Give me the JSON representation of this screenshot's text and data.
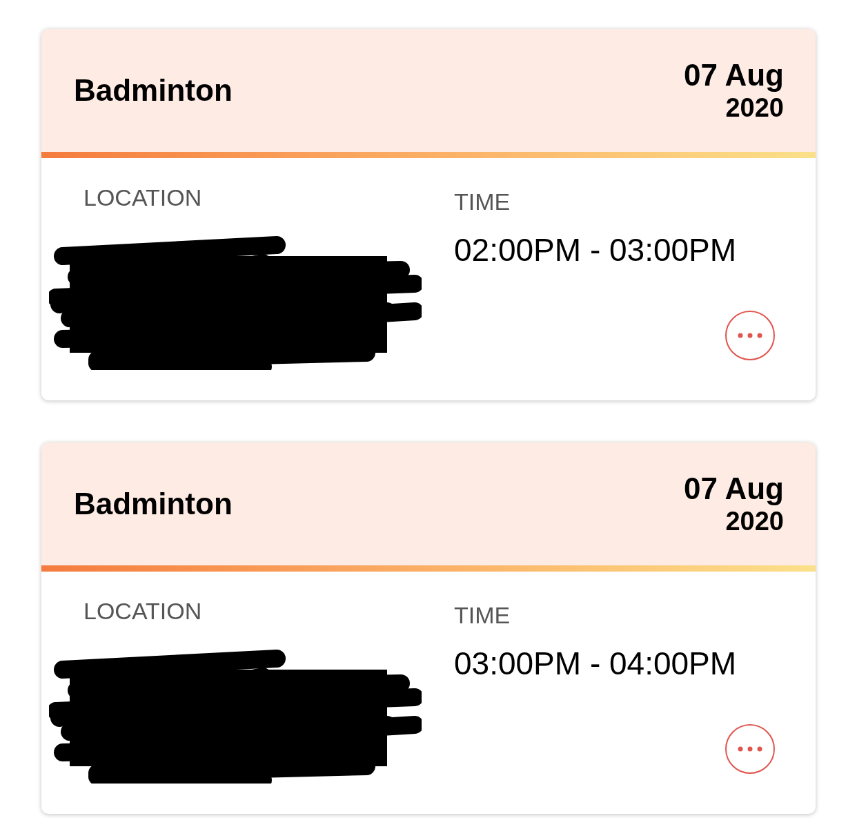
{
  "cards": [
    {
      "title": "Badminton",
      "date": "07 Aug",
      "year": "2020",
      "location_label": "LOCATION",
      "location_redacted": true,
      "time_label": "TIME",
      "time": "02:00PM - 03:00PM"
    },
    {
      "title": "Badminton",
      "date": "07 Aug",
      "year": "2020",
      "location_label": "LOCATION",
      "location_redacted": true,
      "time_label": "TIME",
      "time": "03:00PM - 04:00PM"
    }
  ]
}
